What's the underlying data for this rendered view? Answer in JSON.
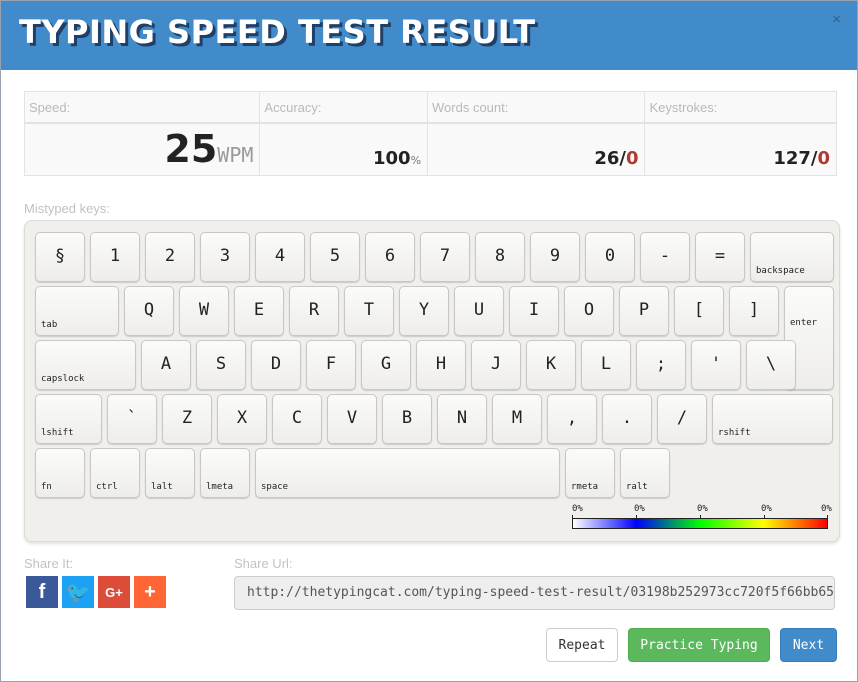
{
  "header": {
    "title": "TYPING SPEED TEST RESULT",
    "close_label": "×"
  },
  "stats": {
    "speed": {
      "label": "Speed:",
      "value": "25",
      "unit": "WPM"
    },
    "accuracy": {
      "label": "Accuracy:",
      "value": "100",
      "unit": "%"
    },
    "words": {
      "label": "Words count:",
      "value": "26/",
      "errors": "0"
    },
    "keystrokes": {
      "label": "Keystrokes:",
      "value": "127/",
      "errors": "0"
    }
  },
  "mistyped_label": "Mistyped keys:",
  "keyboard": {
    "row1": [
      "§",
      "1",
      "2",
      "3",
      "4",
      "5",
      "6",
      "7",
      "8",
      "9",
      "0",
      "-",
      "=",
      "backspace"
    ],
    "row2": [
      "tab",
      "Q",
      "W",
      "E",
      "R",
      "T",
      "Y",
      "U",
      "I",
      "O",
      "P",
      "[",
      "]",
      "enter"
    ],
    "row3": [
      "capslock",
      "A",
      "S",
      "D",
      "F",
      "G",
      "H",
      "J",
      "K",
      "L",
      ";",
      "'",
      "\\"
    ],
    "row4": [
      "lshift",
      "`",
      "Z",
      "X",
      "C",
      "V",
      "B",
      "N",
      "M",
      ",",
      ".",
      "/",
      "rshift"
    ],
    "row5": [
      "fn",
      "ctrl",
      "lalt",
      "lmeta",
      "space",
      "rmeta",
      "ralt"
    ]
  },
  "color_scale": {
    "labels": [
      "0%",
      "0%",
      "0%",
      "0%",
      "0%"
    ],
    "colors": [
      "#ffffff",
      "#0000ff",
      "#00ff00",
      "#ffff00",
      "#ff0000"
    ]
  },
  "share": {
    "label": "Share It:",
    "icons": [
      {
        "name": "facebook-icon",
        "glyph": "f",
        "color": "#3b5998"
      },
      {
        "name": "twitter-icon",
        "glyph": "🐦",
        "color": "#1da1f2"
      },
      {
        "name": "google-plus-icon",
        "glyph": "G+",
        "color": "#dd4b39"
      },
      {
        "name": "more-share-icon",
        "glyph": "+",
        "color": "#ff6633"
      }
    ]
  },
  "share_url": {
    "label": "Share Url:",
    "value": "http://thetypingcat.com/typing-speed-test-result/03198b252973cc720f5f66bb65"
  },
  "buttons": {
    "repeat": "Repeat",
    "practice": "Practice Typing",
    "next": "Next"
  },
  "colors": {
    "header": "#428bca",
    "practice": "#5cb85c",
    "next": "#428bca",
    "error": "#b03a2e"
  }
}
